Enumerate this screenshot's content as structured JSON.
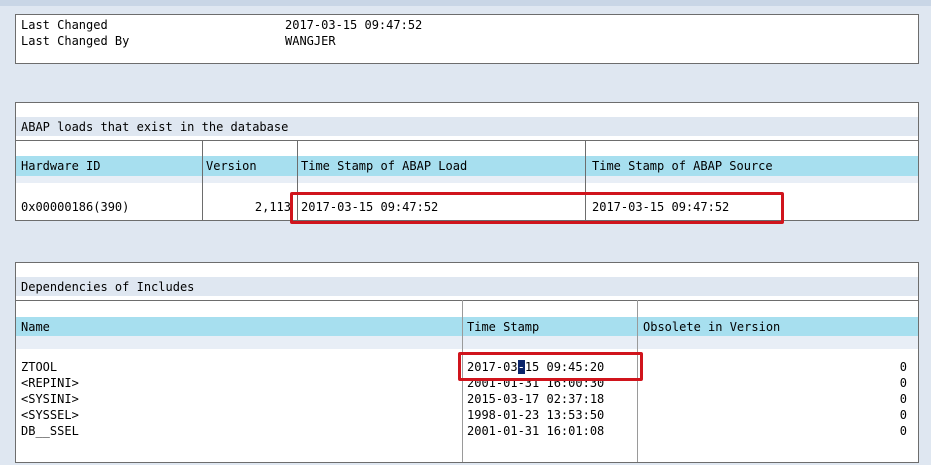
{
  "top_info": {
    "rows": [
      {
        "label": "Last Changed",
        "value": "2017-03-15 09:47:52"
      },
      {
        "label": "Last Changed By",
        "value": "WANGJER"
      }
    ]
  },
  "abap_loads": {
    "title": "ABAP loads that exist in the database",
    "columns": [
      "Hardware ID",
      "Version",
      "Time Stamp of ABAP Load",
      "Time Stamp of ABAP Source"
    ],
    "rows": [
      {
        "hardware_id": "0x00000186(390)",
        "version": "2,113",
        "load_ts": "2017-03-15 09:47:52",
        "source_ts": "2017-03-15 09:47:52"
      }
    ]
  },
  "dependencies": {
    "title": "Dependencies of Includes",
    "columns": [
      "Name",
      "Time Stamp",
      "Obsolete in Version"
    ],
    "rows": [
      {
        "name": "ZTOOL",
        "ts_a": "2017-03",
        "ts_cursor": "-",
        "ts_b": "15 09:45:20",
        "obsolete": "0"
      },
      {
        "name": "<REPINI>",
        "ts": "2001-01-31 16:00:30",
        "obsolete": "0"
      },
      {
        "name": "<SYSINI>",
        "ts": "2015-03-17 02:37:18",
        "obsolete": "0"
      },
      {
        "name": "<SYSSEL>",
        "ts": "1998-01-23 13:53:50",
        "obsolete": "0"
      },
      {
        "name": "DB__SSEL",
        "ts": "2001-01-31 16:01:08",
        "obsolete": "0"
      }
    ]
  },
  "colors": {
    "background": "#dfe7f1",
    "column_header": "#a7dfef",
    "highlight_box": "#d0141c",
    "cursor": "#0a246a"
  }
}
